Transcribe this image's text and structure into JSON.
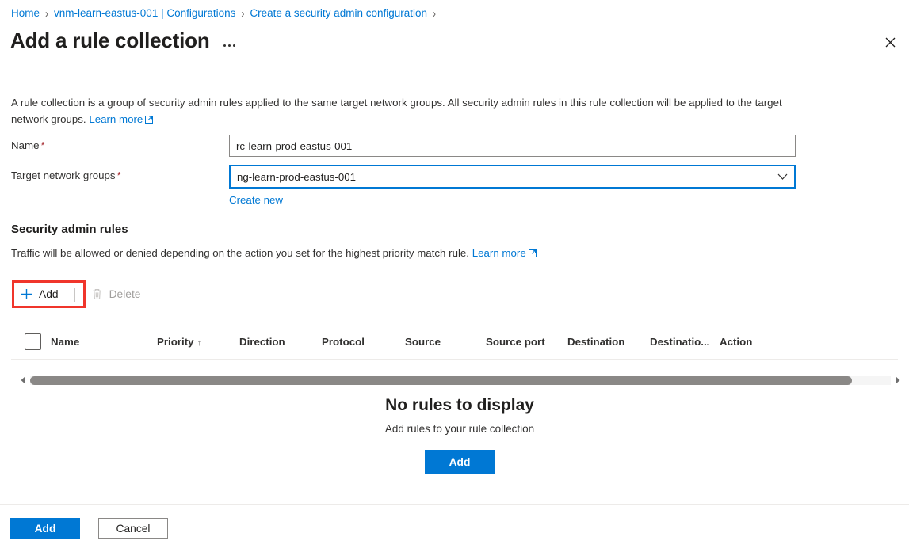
{
  "breadcrumb": {
    "items": [
      {
        "label": "Home"
      },
      {
        "label": "vnm-learn-eastus-001 | Configurations"
      },
      {
        "label": "Create a security admin configuration"
      }
    ],
    "separator": "›"
  },
  "header": {
    "title": "Add a rule collection",
    "more_menu": "…",
    "close": "✕"
  },
  "intro": {
    "text": "A rule collection is a group of security admin rules applied to the same target network groups. All security admin rules in this rule collection will be applied to the target network groups.",
    "learn_more": "Learn more"
  },
  "form": {
    "name": {
      "label": "Name",
      "required": "*",
      "value": "rc-learn-prod-eastus-001",
      "placeholder": ""
    },
    "target_network_groups": {
      "label": "Target network groups",
      "required": "*",
      "value": "ng-learn-prod-eastus-001",
      "chevron": "⌄",
      "create_new": "Create new"
    }
  },
  "section": {
    "title": "Security admin rules",
    "description": "Traffic will be allowed or denied depending on the action you set for the highest priority match rule.",
    "learn_more": "Learn more"
  },
  "toolbar": {
    "add_label": "Add",
    "add_icon": "plus-icon",
    "delete_label": "Delete",
    "delete_icon": "trash-icon",
    "delete_disabled": true
  },
  "table": {
    "columns": [
      {
        "label": "Name",
        "sort": ""
      },
      {
        "label": "Priority",
        "sort": "↑"
      },
      {
        "label": "Direction",
        "sort": ""
      },
      {
        "label": "Protocol",
        "sort": ""
      },
      {
        "label": "Source",
        "sort": ""
      },
      {
        "label": "Source port",
        "sort": ""
      },
      {
        "label": "Destination",
        "sort": ""
      },
      {
        "label": "Destinatio...",
        "sort": ""
      },
      {
        "label": "Action",
        "sort": ""
      }
    ],
    "rows": [],
    "scroll_left_arrow": "◀",
    "scroll_right_arrow": "▶"
  },
  "empty_state": {
    "title": "No rules to display",
    "subtitle": "Add rules to your rule collection",
    "add_label": "Add"
  },
  "footer": {
    "add_label": "Add",
    "cancel_label": "Cancel"
  },
  "colors": {
    "accent": "#0078d4",
    "required": "#a4262c",
    "highlight": "#f0352b",
    "disabled_text": "#a19f9d"
  }
}
